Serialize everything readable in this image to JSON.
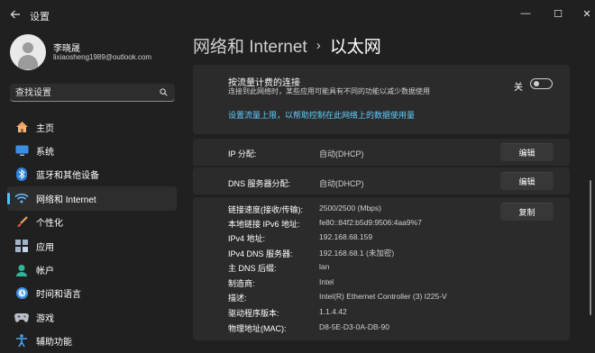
{
  "window": {
    "title": "设置",
    "controls": {
      "minimize": "—",
      "maximize": "☐",
      "close": "✕"
    }
  },
  "profile": {
    "name": "李晓晟",
    "email": "lixiaosheng1989@outlook.com"
  },
  "search": {
    "placeholder": "查找设置"
  },
  "sidebar": {
    "items": [
      {
        "label": "主页",
        "icon": "home-icon",
        "active": false
      },
      {
        "label": "系统",
        "icon": "system-icon",
        "active": false
      },
      {
        "label": "蓝牙和其他设备",
        "icon": "bluetooth-icon",
        "active": false
      },
      {
        "label": "网络和 Internet",
        "icon": "network-icon",
        "active": true
      },
      {
        "label": "个性化",
        "icon": "brush-icon",
        "active": false
      },
      {
        "label": "应用",
        "icon": "apps-icon",
        "active": false
      },
      {
        "label": "帐户",
        "icon": "account-icon",
        "active": false
      },
      {
        "label": "时间和语言",
        "icon": "time-language-icon",
        "active": false
      },
      {
        "label": "游戏",
        "icon": "gaming-icon",
        "active": false
      },
      {
        "label": "辅助功能",
        "icon": "accessibility-icon",
        "active": false
      }
    ]
  },
  "breadcrumb": {
    "parent": "网络和 Internet",
    "separator": "›",
    "current": "以太网"
  },
  "metered": {
    "title": "按流量计费的连接",
    "description": "连接到此网络时，某些应用可能具有不同的功能以减少数据使用",
    "toggle_label": "关",
    "link": "设置流量上限，以帮助控制在此网络上的数据使用量"
  },
  "ip_assignment": {
    "label": "IP 分配:",
    "value": "自动(DHCP)",
    "button": "编辑"
  },
  "dns_assignment": {
    "label": "DNS 服务器分配:",
    "value": "自动(DHCP)",
    "button": "编辑"
  },
  "properties": {
    "copy_button": "复制",
    "rows": [
      {
        "key": "链接速度(接收/传输):",
        "value": "2500/2500 (Mbps)"
      },
      {
        "key": "本地链接 IPv6 地址:",
        "value": "fe80::84f2:b5d9:9506:4aa9%7"
      },
      {
        "key": "IPv4 地址:",
        "value": "192.168.68.159"
      },
      {
        "key": "IPv4 DNS 服务器:",
        "value": "192.168.68.1 (未加密)"
      },
      {
        "key": "主 DNS 后缀:",
        "value": "lan"
      },
      {
        "key": "制造商:",
        "value": "Intel"
      },
      {
        "key": "描述:",
        "value": "Intel(R) Ethernet Controller (3) I225-V"
      },
      {
        "key": "驱动程序版本:",
        "value": "1.1.4.42"
      },
      {
        "key": "物理地址(MAC):",
        "value": "D8-5E-D3-0A-DB-90"
      }
    ]
  },
  "colors": {
    "accent": "#4cc2ff",
    "link": "#60cdff",
    "background": "#202020",
    "card": "#2b2b2b"
  }
}
